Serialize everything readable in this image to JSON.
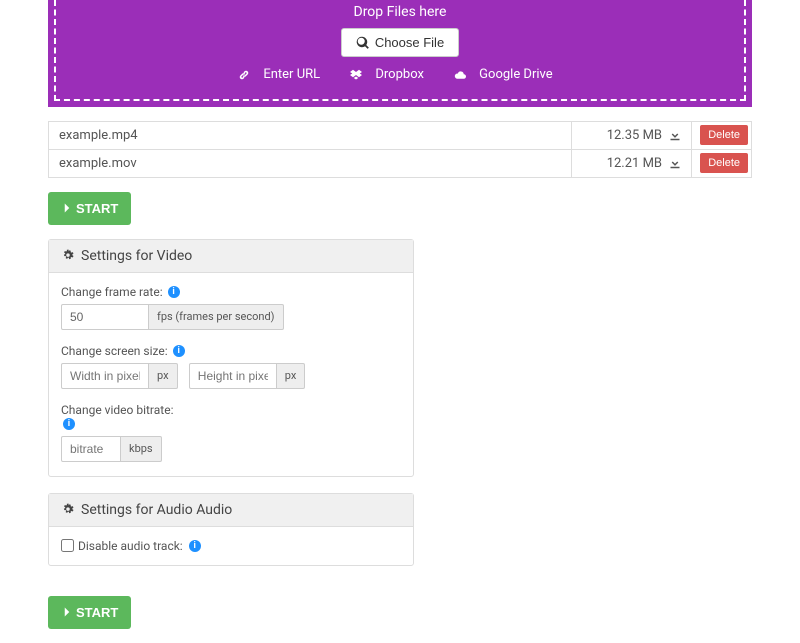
{
  "dropzone": {
    "drop_label": "Drop Files here",
    "choose_label": "Choose File",
    "enter_url": "Enter URL",
    "dropbox": "Dropbox",
    "gdrive": "Google Drive"
  },
  "files": [
    {
      "name": "example.mp4",
      "size": "12.35 MB",
      "delete_label": "Delete"
    },
    {
      "name": "example.mov",
      "size": "12.21 MB",
      "delete_label": "Delete"
    }
  ],
  "start_label": "START",
  "video_settings": {
    "heading": "Settings for Video",
    "framerate_label": "Change frame rate:",
    "framerate_value": "50",
    "framerate_addon": "fps (frames per second)",
    "screensize_label": "Change screen size:",
    "width_placeholder": "Width in pixels",
    "height_placeholder": "Height in pixels",
    "px_addon": "px",
    "bitrate_label": "Change video bitrate:",
    "bitrate_placeholder": "bitrate",
    "bitrate_addon": "kbps"
  },
  "audio_settings": {
    "heading": "Settings for Audio Audio",
    "disable_label": "Disable audio track:"
  }
}
